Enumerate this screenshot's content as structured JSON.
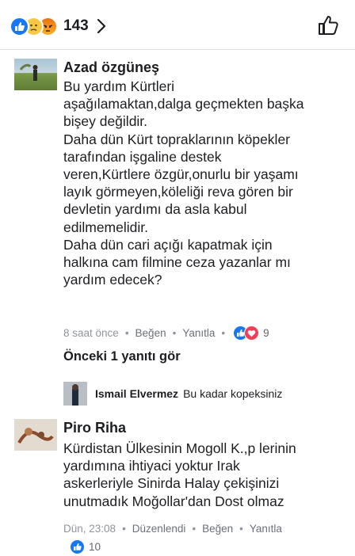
{
  "header": {
    "reaction_count": "143",
    "reaction_icons": [
      "like-icon",
      "sad-icon",
      "angry-icon"
    ],
    "more_icon": "chevron-right-icon",
    "like_icon": "thumbs-up-icon"
  },
  "comments": [
    {
      "author": "Azad özgüneş",
      "text": "Bu yardım Kürtleri\naşağılamaktan,dalga geçmekten başka\nbişey değildir.\nDaha dün Kürt topraklarının köpekler\ntarafından işgaline destek\nveren,Kürtlere özgür,onurlu bir yaşamı\nlayık görmeyen,köleliği reva gören bir\ndevletin yardımı da asla kabul\nedilmemelidir.\nDaha dün cari açığı kapatmak için\nhalkına cam filmine ceza yazanlar  mı\nyardım edecek?",
      "time": "8 saat önce",
      "like_label": "Beğen",
      "reply_label": "Yanıtla",
      "reaction_count": "9",
      "previous_replies": "Önceki 1 yanıtı gör",
      "reply": {
        "author": "Ismail Elvermez",
        "text": "Bu kadar kopeksiniz"
      }
    },
    {
      "author": "Piro Riha",
      "text": "Kürdistan Ülkesinin Mogoll K.,p lerinin\nyardımına ihtiyaci yoktur Irak\naskerleriyle Sinirda Halay çekişinizi\nunutmadık Moğollar'dan Dost olmaz",
      "time": "Dün, 23:08",
      "edited_label": "Düzenlendi",
      "like_label": "Beğen",
      "reply_label": "Yanıtla",
      "reaction_count": "10"
    }
  ],
  "colors": {
    "accent": "#1877f2",
    "meta_text": "#90949c",
    "love": "#f33e58"
  }
}
